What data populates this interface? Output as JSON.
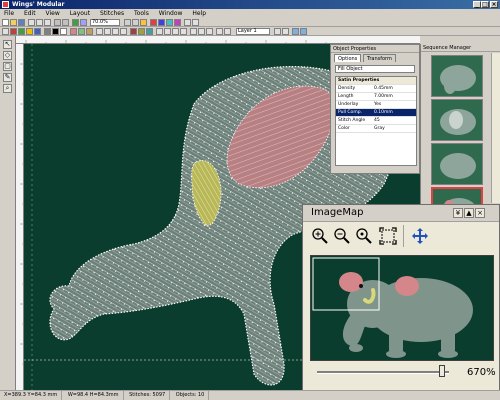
{
  "window": {
    "title": "Wings' Modular"
  },
  "menu": [
    "File",
    "Edit",
    "View",
    "Layout",
    "Stitches",
    "Tools",
    "Window",
    "Help"
  ],
  "toolbar": {
    "zoom_value": "70.0%",
    "layer_value": "Layer 1"
  },
  "properties": {
    "title": "Object Properties",
    "tabs": [
      "Options",
      "Transform"
    ],
    "selected_object": "Fill Object",
    "rows": [
      {
        "key": "Satin Properties",
        "value": ""
      },
      {
        "key": "Density",
        "value": "0.45mm"
      },
      {
        "key": "Length",
        "value": "7.00mm"
      },
      {
        "key": "Underlay",
        "value": "Yes"
      },
      {
        "key": "Pull Comp.",
        "value": "0.10mm"
      },
      {
        "key": "Stitch Angle",
        "value": "45"
      },
      {
        "key": "Color",
        "value": "Gray"
      }
    ]
  },
  "thumbnails": {
    "title": "Sequence Manager"
  },
  "imagemap": {
    "title": "ImageMap",
    "zoom_label": "670%",
    "zoom_level_percent": 97
  },
  "statusbar": {
    "coords": "X=389.3 Y=84.3 mm",
    "size": "W=98.4 H=84.3mm",
    "stitches": "Stitches: 5097",
    "objects": "Objects: 10"
  },
  "colors": {
    "canvas_bg": "#0a3d2d",
    "elephant_body": "#7a8e85",
    "ear_inner": "#d4868a",
    "tusk": "#d8d77a",
    "stitch": "#ffffff"
  }
}
